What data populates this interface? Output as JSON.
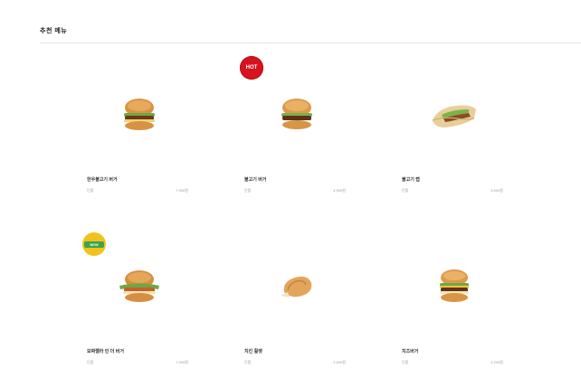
{
  "section": {
    "title": "추천 메뉴"
  },
  "badges": {
    "hot": "HOT",
    "new": "NEW"
  },
  "menu_items": [
    {
      "name": "한우불고기 버거",
      "sub": "단품",
      "price": "7,900원",
      "icon": "burger-icon"
    },
    {
      "name": "불고기 버거",
      "sub": "단품",
      "price": "4,900원",
      "icon": "burger-icon"
    },
    {
      "name": "불고기 랩",
      "sub": "단품",
      "price": "3,900원",
      "icon": "wrap-icon"
    },
    {
      "name": "모짜렐라 인 더 버거",
      "sub": "단품",
      "price": "7,200원",
      "icon": "burger-icon"
    },
    {
      "name": "치킨 휠렛",
      "sub": "단품",
      "price": "2,500원",
      "icon": "chicken-icon"
    },
    {
      "name": "치즈버거",
      "sub": "단품",
      "price": "4,200원",
      "icon": "burger-icon"
    }
  ],
  "colors": {
    "hot_badge": "#d7131f",
    "new_badge_ring": "#f1c21b",
    "new_badge_band": "#3aa54a"
  }
}
